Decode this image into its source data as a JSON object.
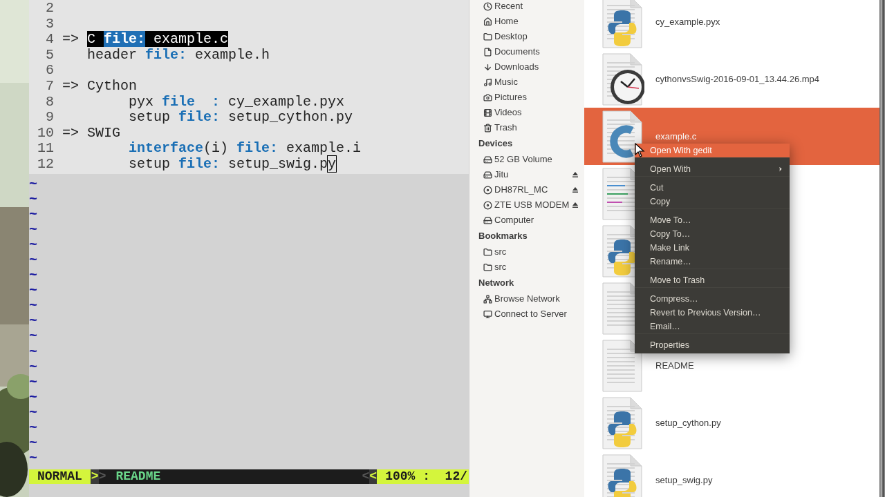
{
  "editor": {
    "lines": [
      {
        "number": "2"
      },
      {
        "number": "3"
      },
      {
        "number": "4",
        "segments": [
          {
            "text": "=> ",
            "kind": "plain"
          },
          {
            "text": "C ",
            "kind": "visual"
          },
          {
            "text": "file:",
            "kind": "visual_keyword"
          },
          {
            "text": " example.c",
            "kind": "visual"
          }
        ]
      },
      {
        "number": "5",
        "segments": [
          {
            "text": "   header ",
            "kind": "plain"
          },
          {
            "text": "file:",
            "kind": "keyword"
          },
          {
            "text": " example.h",
            "kind": "plain"
          }
        ]
      },
      {
        "number": "6"
      },
      {
        "number": "7",
        "segments": [
          {
            "text": "=> Cython",
            "kind": "plain"
          }
        ]
      },
      {
        "number": "8",
        "segments": [
          {
            "text": "        pyx ",
            "kind": "plain"
          },
          {
            "text": "file  :",
            "kind": "keyword"
          },
          {
            "text": " cy_example.pyx",
            "kind": "plain"
          }
        ]
      },
      {
        "number": "9",
        "segments": [
          {
            "text": "        setup ",
            "kind": "plain"
          },
          {
            "text": "file:",
            "kind": "keyword"
          },
          {
            "text": " setup_cython.py",
            "kind": "plain"
          }
        ]
      },
      {
        "number": "10",
        "segments": [
          {
            "text": "=> SWIG",
            "kind": "plain"
          }
        ]
      },
      {
        "number": "11",
        "segments": [
          {
            "text": "        interface",
            "kind": "keyword"
          },
          {
            "text": "(i) ",
            "kind": "plain"
          },
          {
            "text": "file:",
            "kind": "keyword"
          },
          {
            "text": " example.i",
            "kind": "plain"
          }
        ]
      },
      {
        "number": "12",
        "segments": [
          {
            "text": "        setup ",
            "kind": "plain"
          },
          {
            "text": "file:",
            "kind": "keyword"
          },
          {
            "text": " setup_swig.p",
            "kind": "plain"
          },
          {
            "text": "y",
            "kind": "cursor"
          }
        ]
      }
    ],
    "tildes": [
      "~",
      "~",
      "~",
      "~",
      "~",
      "~",
      "~",
      "~",
      "~",
      "~",
      "~",
      "~",
      "~",
      "~",
      "~",
      "~",
      "~",
      "~",
      "~"
    ],
    "status_bar": {
      "mode": "NORMAL",
      "left_arrows": [
        ">",
        ">"
      ],
      "file": "README",
      "right_arrows": [
        "<",
        "<"
      ],
      "position": "100% :  12/"
    }
  },
  "sidebar": {
    "places": [
      {
        "label": "Recent",
        "kind": "clock",
        "eject": false
      },
      {
        "label": "Home",
        "kind": "home",
        "eject": false
      },
      {
        "label": "Desktop",
        "kind": "folder",
        "eject": false
      },
      {
        "label": "Documents",
        "kind": "document",
        "eject": false
      },
      {
        "label": "Downloads",
        "kind": "download",
        "eject": false
      },
      {
        "label": "Music",
        "kind": "music",
        "eject": false
      },
      {
        "label": "Pictures",
        "kind": "camera",
        "eject": false
      },
      {
        "label": "Videos",
        "kind": "film",
        "eject": false
      },
      {
        "label": "Trash",
        "kind": "trash",
        "eject": false
      }
    ],
    "sections": [
      {
        "title": "Devices",
        "items": [
          {
            "label": "52 GB Volume",
            "kind": "drive",
            "eject": false
          },
          {
            "label": "Jitu",
            "kind": "drive",
            "eject": true
          },
          {
            "label": "DH87RL_MC",
            "kind": "disc",
            "eject": true
          },
          {
            "label": "ZTE USB MODEM",
            "kind": "disc",
            "eject": true
          },
          {
            "label": "Computer",
            "kind": "drive",
            "eject": false
          }
        ]
      },
      {
        "title": "Bookmarks",
        "items": [
          {
            "label": "src",
            "kind": "folder",
            "eject": false
          },
          {
            "label": "src",
            "kind": "folder",
            "eject": false
          }
        ]
      },
      {
        "title": "Network",
        "items": [
          {
            "label": "Browse Network",
            "kind": "network",
            "eject": false
          },
          {
            "label": "Connect to Server",
            "kind": "server",
            "eject": false
          }
        ]
      }
    ]
  },
  "files": [
    {
      "name": "cy_example.pyx",
      "kind": "python",
      "selected": false
    },
    {
      "name": "cythonvsSwig-2016-09-01_13.44.26.mp4",
      "kind": "clock",
      "selected": false
    },
    {
      "name": "example.c",
      "kind": "c",
      "selected": true
    },
    {
      "kind": "code",
      "selected": false
    },
    {
      "kind": "python",
      "selected": false
    },
    {
      "kind": "text",
      "selected": false
    },
    {
      "name": "README",
      "kind": "text",
      "selected": false
    },
    {
      "name": "setup_cython.py",
      "kind": "python",
      "selected": false
    },
    {
      "name": "setup_swig.py",
      "kind": "python",
      "selected": false
    }
  ],
  "context_menu": {
    "items": [
      {
        "label": "Open With gedit",
        "selected": true,
        "submenu": false,
        "gap_before": false
      },
      {
        "label": "Open With",
        "selected": false,
        "submenu": true,
        "gap_before": true
      },
      {
        "label": "Cut",
        "selected": false,
        "submenu": false,
        "gap_before": true
      },
      {
        "label": "Copy",
        "selected": false,
        "submenu": false,
        "gap_before": false
      },
      {
        "label": "Move To…",
        "selected": false,
        "submenu": false,
        "gap_before": true
      },
      {
        "label": "Copy To…",
        "selected": false,
        "submenu": false,
        "gap_before": false
      },
      {
        "label": "Make Link",
        "selected": false,
        "submenu": false,
        "gap_before": false
      },
      {
        "label": "Rename…",
        "selected": false,
        "submenu": false,
        "gap_before": false
      },
      {
        "label": "Move to Trash",
        "selected": false,
        "submenu": false,
        "gap_before": true
      },
      {
        "label": "Compress…",
        "selected": false,
        "submenu": false,
        "gap_before": true
      },
      {
        "label": "Revert to Previous Version…",
        "selected": false,
        "submenu": false,
        "gap_before": false
      },
      {
        "label": "Email…",
        "selected": false,
        "submenu": false,
        "gap_before": false
      },
      {
        "label": "Properties",
        "selected": false,
        "submenu": false,
        "gap_before": true
      }
    ]
  }
}
